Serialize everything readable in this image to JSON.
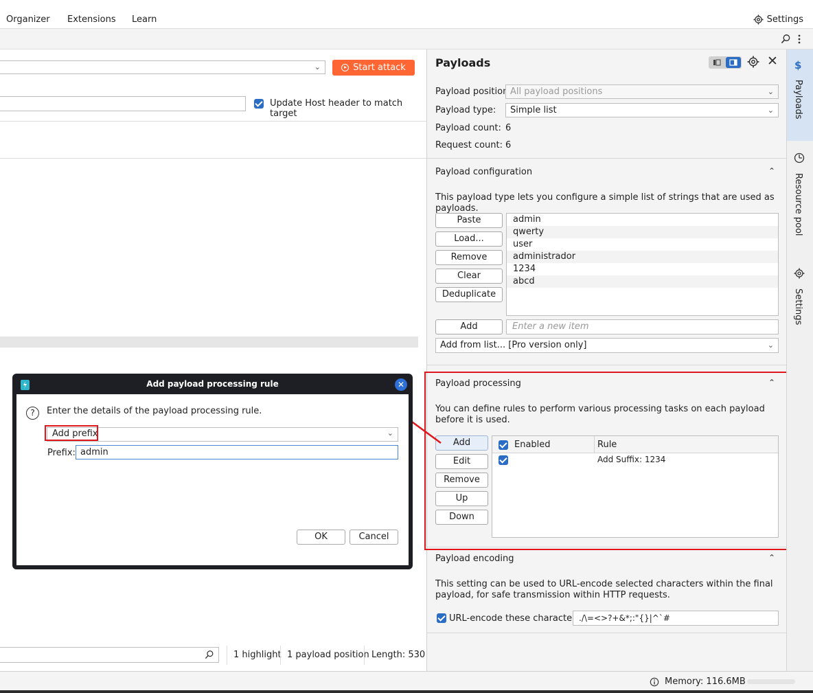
{
  "menu": {
    "items": [
      "Organizer",
      "Extensions",
      "Learn"
    ],
    "settings_label": "Settings"
  },
  "left": {
    "start_attack_label": "Start attack",
    "update_host_label": "Update Host header to match target",
    "status": {
      "highlight": "1 highlight",
      "positions": "1 payload position",
      "length": "Length: 530"
    }
  },
  "payloads": {
    "title": "Payloads",
    "position_label": "Payload position:",
    "position_value": "All payload positions",
    "type_label": "Payload type:",
    "type_value": "Simple list",
    "count_label": "Payload count:",
    "count_value": "6",
    "request_label": "Request count:",
    "request_value": "6",
    "config": {
      "title": "Payload configuration",
      "description": "This payload type lets you configure a simple list of strings that are used as payloads.",
      "buttons": [
        "Paste",
        "Load...",
        "Remove",
        "Clear",
        "Deduplicate"
      ],
      "items": [
        "admin",
        "qwerty",
        "user",
        "administrador",
        "1234",
        "abcd"
      ],
      "add_label": "Add",
      "add_placeholder": "Enter a new item",
      "add_from_list": "Add from list... [Pro version only]"
    },
    "processing": {
      "title": "Payload processing",
      "description": "You can define rules to perform various processing tasks on each payload before it is used.",
      "buttons": [
        "Add",
        "Edit",
        "Remove",
        "Up",
        "Down"
      ],
      "columns": [
        "Enabled",
        "Rule"
      ],
      "rule": "Add Suffix: 1234"
    },
    "encoding": {
      "title": "Payload encoding",
      "description": "This setting can be used to URL-encode selected characters within the final payload, for safe transmission within HTTP requests.",
      "checkbox_label": "URL-encode these characters:",
      "chars": "./\\=<>?+&*;:\"{}|^`#"
    }
  },
  "side_tabs": [
    "Payloads",
    "Resource pool",
    "Settings"
  ],
  "status_bar": {
    "memory": "Memory: 116.6MB"
  },
  "dialog": {
    "title": "Add payload processing rule",
    "instruction": "Enter the details of the payload processing rule.",
    "rule_type": "Add prefix",
    "prefix_label": "Prefix:",
    "prefix_value": "admin",
    "ok_label": "OK",
    "cancel_label": "Cancel"
  },
  "colors": {
    "accent": "#ff6633",
    "blue": "#2b6cc4",
    "highlight_red": "#e0161c"
  }
}
